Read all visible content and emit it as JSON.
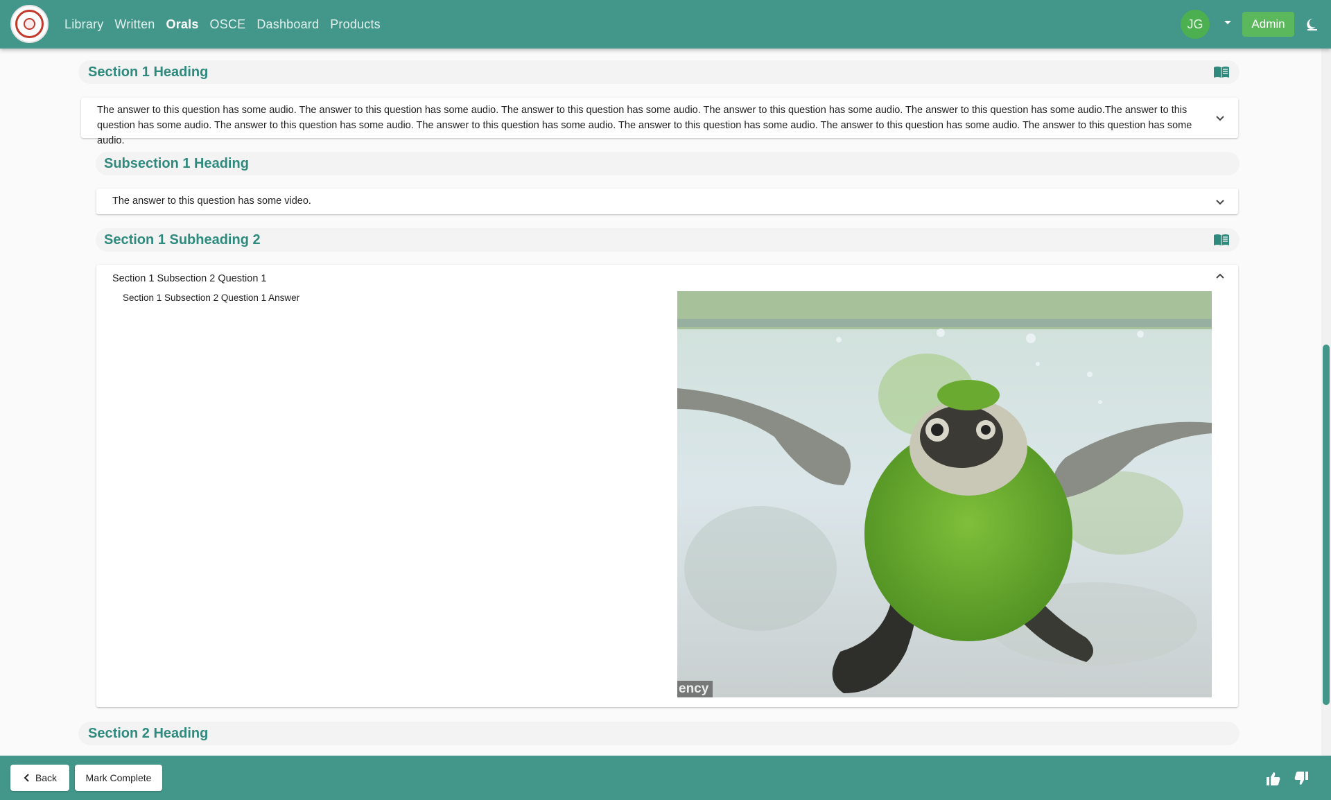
{
  "nav": {
    "items": [
      {
        "label": "Library",
        "active": false
      },
      {
        "label": "Written",
        "active": false
      },
      {
        "label": "Orals",
        "active": true
      },
      {
        "label": "OSCE",
        "active": false
      },
      {
        "label": "Dashboard",
        "active": false
      },
      {
        "label": "Products",
        "active": false
      }
    ],
    "avatar_initials": "JG",
    "admin_label": "Admin"
  },
  "colors": {
    "brand": "#43968a",
    "heading_text": "#2f8a7e",
    "avatar": "#4caf50",
    "admin_button": "#5cb85c"
  },
  "sections": [
    {
      "title": "Section 1 Heading"
    },
    {
      "title": "Subsection 1 Heading"
    },
    {
      "title": "Section 1 Subheading 2"
    },
    {
      "title": "Section 2 Heading"
    }
  ],
  "questions": {
    "audio": "The answer to this question has some audio. The answer to this question has some audio. The answer to this question has some audio. The answer to this question has some audio. The answer to this question has some audio.The answer to this question has some audio. The answer to this question has some audio. The answer to this question has some audio. The answer to this question has some audio. The answer to this question has some audio. The answer to this question has some audio.",
    "video": "The answer to this question has some video.",
    "expanded_title": "Section 1 Subsection 2 Question 1",
    "expanded_answer": "Section 1 Subsection 2 Question 1 Answer",
    "media_watermark": "ency"
  },
  "footer": {
    "back_label": "Back",
    "mark_complete_label": "Mark Complete"
  },
  "icons": {
    "logo": "university-seal-logo",
    "theme": "theme-toggle-icon",
    "book": "book-open-icon",
    "chevron_down": "chevron-down-icon",
    "chevron_up": "chevron-up-icon",
    "back": "chevron-left-icon",
    "thumbs_up": "thumbs-up-icon",
    "thumbs_down": "thumbs-down-icon"
  }
}
